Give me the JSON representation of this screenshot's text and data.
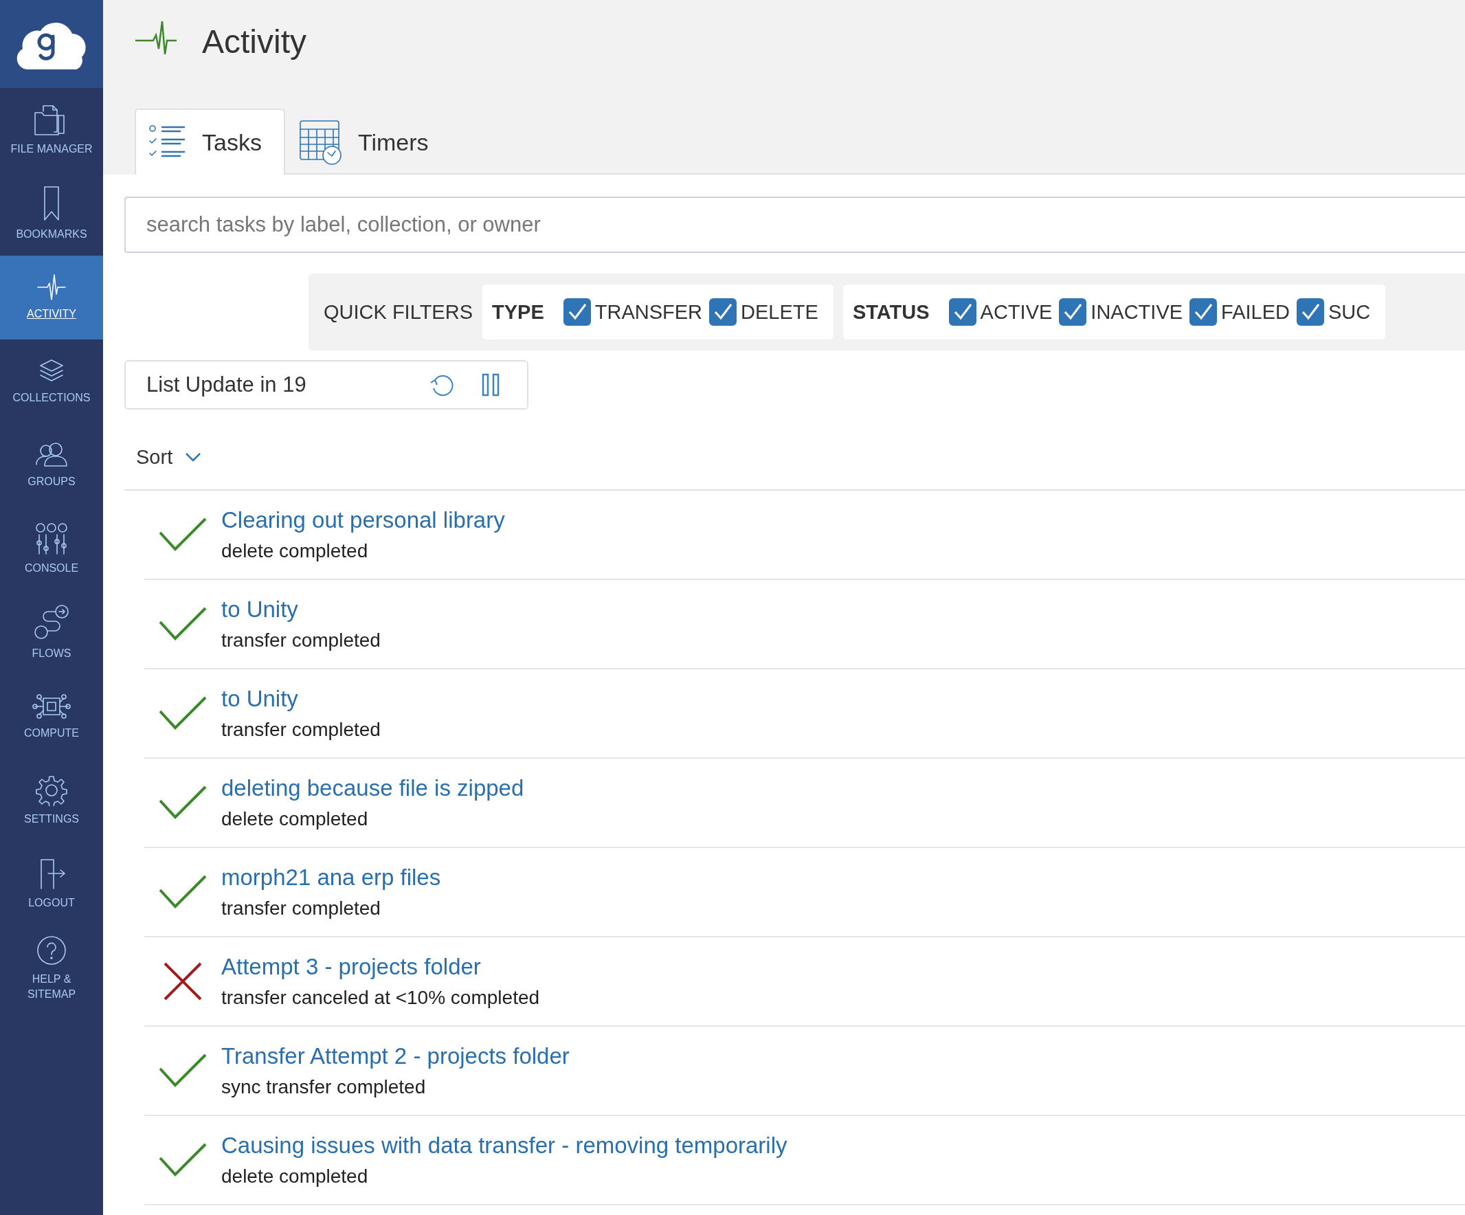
{
  "sidebar": {
    "items": [
      {
        "label": "FILE MANAGER",
        "selected": false
      },
      {
        "label": "BOOKMARKS",
        "selected": false
      },
      {
        "label": "ACTIVITY",
        "selected": true
      },
      {
        "label": "COLLECTIONS",
        "selected": false
      },
      {
        "label": "GROUPS",
        "selected": false
      },
      {
        "label": "CONSOLE",
        "selected": false
      },
      {
        "label": "FLOWS",
        "selected": false
      },
      {
        "label": "COMPUTE",
        "selected": false
      },
      {
        "label": "SETTINGS",
        "selected": false
      },
      {
        "label": "LOGOUT",
        "selected": false
      },
      {
        "label": "HELP & SITEMAP",
        "selected": false
      }
    ]
  },
  "header": {
    "title": "Activity"
  },
  "tabs": [
    {
      "label": "Tasks",
      "selected": true
    },
    {
      "label": "Timers",
      "selected": false
    }
  ],
  "search": {
    "placeholder": "search tasks by label, collection, or owner"
  },
  "quick_filters": {
    "label": "QUICK FILTERS",
    "groups": [
      {
        "label": "TYPE",
        "options": [
          {
            "label": "TRANSFER",
            "checked": true
          },
          {
            "label": "DELETE",
            "checked": true
          }
        ]
      },
      {
        "label": "STATUS",
        "options": [
          {
            "label": "ACTIVE",
            "checked": true
          },
          {
            "label": "INACTIVE",
            "checked": true
          },
          {
            "label": "FAILED",
            "checked": true
          },
          {
            "label": "SUC",
            "checked": true
          }
        ]
      }
    ]
  },
  "list_update": {
    "text": "List Update in 19"
  },
  "sort": {
    "label": "Sort"
  },
  "tasks": [
    {
      "title": "Clearing out personal library",
      "status_text": "delete completed",
      "kind": "succeeded"
    },
    {
      "title": "to Unity",
      "status_text": "transfer completed",
      "kind": "succeeded"
    },
    {
      "title": "to Unity",
      "status_text": "transfer completed",
      "kind": "succeeded"
    },
    {
      "title": "deleting because file is zipped",
      "status_text": "delete completed",
      "kind": "succeeded"
    },
    {
      "title": "morph21 ana erp files",
      "status_text": "transfer completed",
      "kind": "succeeded"
    },
    {
      "title": "Attempt 3 - projects folder",
      "status_text": "transfer canceled at <10% completed",
      "kind": "failed"
    },
    {
      "title": "Transfer Attempt 2 - projects folder",
      "status_text": "sync transfer completed",
      "kind": "succeeded"
    },
    {
      "title": "Causing issues with data transfer - removing temporarily",
      "status_text": "delete completed",
      "kind": "succeeded"
    }
  ]
}
